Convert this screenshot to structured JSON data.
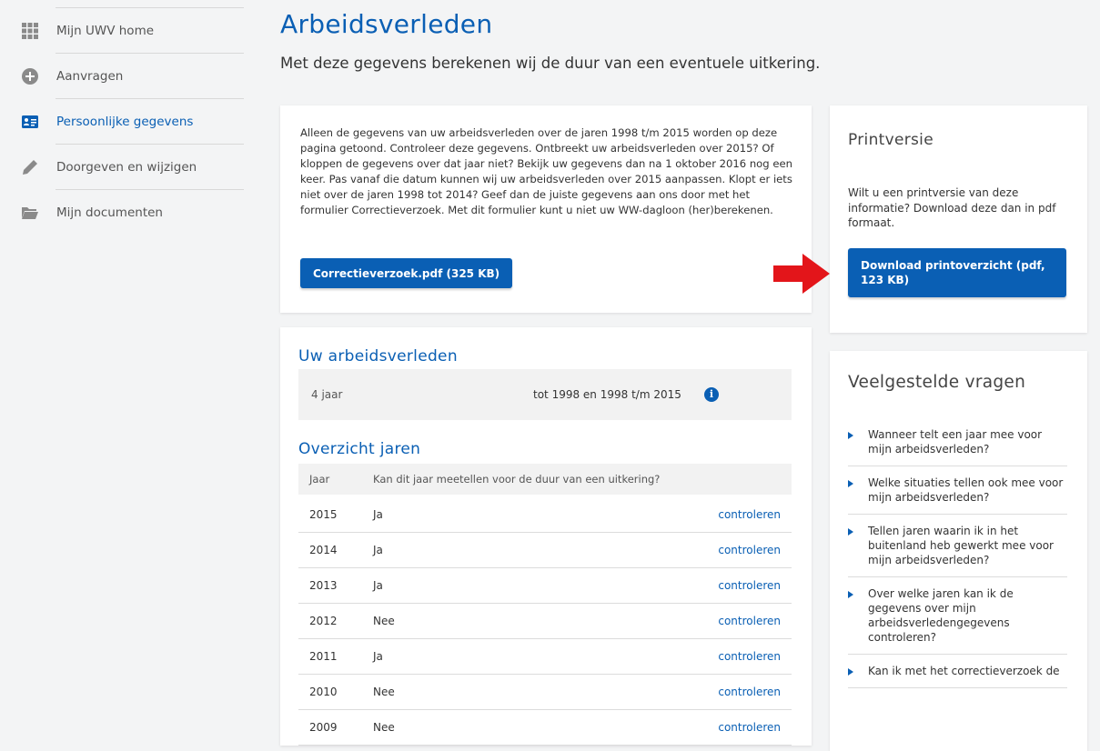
{
  "sidebar": {
    "items": [
      {
        "label": "Mijn UWV home",
        "icon": "grid-icon"
      },
      {
        "label": "Aanvragen",
        "icon": "plus-circle-icon"
      },
      {
        "label": "Persoonlijke gegevens",
        "icon": "id-card-icon",
        "active": true
      },
      {
        "label": "Doorgeven en wijzigen",
        "icon": "pencil-icon"
      },
      {
        "label": "Mijn documenten",
        "icon": "folder-icon"
      }
    ]
  },
  "header": {
    "title": "Arbeidsverleden",
    "subtitle": "Met deze gegevens berekenen wij de duur van een eventuele uitkering."
  },
  "intro": {
    "text": "Alleen de gegevens van uw arbeidsverleden over de jaren 1998 t/m 2015 worden op deze pagina getoond. Controleer deze gegevens. Ontbreekt uw arbeidsverleden over 2015? Of kloppen de gegevens over dat jaar niet? Bekijk uw gegevens dan na 1 oktober 2016 nog een keer. Pas vanaf die datum kunnen wij uw arbeidsverleden over 2015 aanpassen. Klopt er iets niet over de jaren 1998 tot 2014? Geef dan de juiste gegevens aan ons door met het formulier Correctieverzoek. Met dit formulier kunt u niet uw WW-dagloon (her)berekenen.",
    "button_label": "Correctieverzoek.pdf (325 KB)"
  },
  "print": {
    "title": "Printversie",
    "text": "Wilt u een printversie van deze informatie? Download deze dan in pdf formaat.",
    "button_label": "Download printoverzicht (pdf, 123 KB)"
  },
  "history": {
    "title": "Uw arbeidsverleden",
    "summary_years": "4 jaar",
    "summary_period": "tot 1998 en 1998 t/m 2015",
    "info_glyph": "i",
    "overview_title": "Overzicht jaren",
    "col_year": "Jaar",
    "col_question": "Kan dit jaar meetellen voor de duur van een uitkering?",
    "rows": [
      {
        "year": "2015",
        "value": "Ja",
        "action": "controleren"
      },
      {
        "year": "2014",
        "value": "Ja",
        "action": "controleren"
      },
      {
        "year": "2013",
        "value": "Ja",
        "action": "controleren"
      },
      {
        "year": "2012",
        "value": "Nee",
        "action": "controleren"
      },
      {
        "year": "2011",
        "value": "Ja",
        "action": "controleren"
      },
      {
        "year": "2010",
        "value": "Nee",
        "action": "controleren"
      },
      {
        "year": "2009",
        "value": "Nee",
        "action": "controleren"
      }
    ]
  },
  "faq": {
    "title": "Veelgestelde vragen",
    "items": [
      "Wanneer telt een jaar mee voor mijn arbeidsverleden?",
      "Welke situaties tellen ook mee voor mijn arbeidsverleden?",
      "Tellen jaren waarin ik in het buitenland heb gewerkt mee voor mijn arbeidsverleden?",
      "Over welke jaren kan ik de gegevens over mijn arbeidsverledengegevens controleren?",
      "Kan ik met het correctieverzoek de"
    ]
  },
  "colors": {
    "accent": "#0a5fb4",
    "arrow": "#e3151a",
    "background": "#f3f4f5"
  }
}
